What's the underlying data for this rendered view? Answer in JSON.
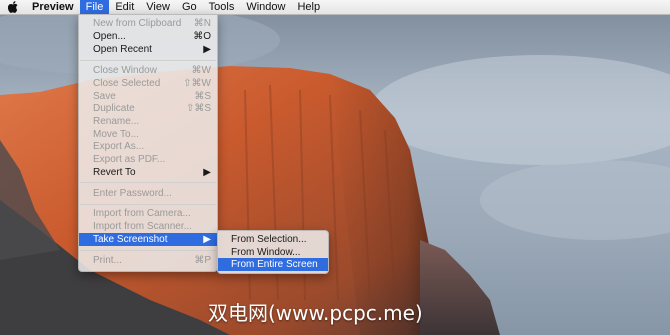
{
  "menubar": {
    "app_name": "Preview",
    "items": [
      "File",
      "Edit",
      "View",
      "Go",
      "Tools",
      "Window",
      "Help"
    ]
  },
  "file_menu": {
    "items": [
      {
        "label": "New from Clipboard",
        "shortcut": "⌘N",
        "enabled": false
      },
      {
        "label": "Open...",
        "shortcut": "⌘O",
        "enabled": true
      },
      {
        "label": "Open Recent",
        "shortcut": "▶",
        "enabled": true
      },
      {
        "label": "Close Window",
        "shortcut": "⌘W",
        "enabled": false
      },
      {
        "label": "Close Selected",
        "shortcut": "⇧⌘W",
        "enabled": false
      },
      {
        "label": "Save",
        "shortcut": "⌘S",
        "enabled": false
      },
      {
        "label": "Duplicate",
        "shortcut": "⇧⌘S",
        "enabled": false
      },
      {
        "label": "Rename...",
        "shortcut": "",
        "enabled": false
      },
      {
        "label": "Move To...",
        "shortcut": "",
        "enabled": false
      },
      {
        "label": "Export As...",
        "shortcut": "",
        "enabled": false
      },
      {
        "label": "Export as PDF...",
        "shortcut": "",
        "enabled": false
      },
      {
        "label": "Revert To",
        "shortcut": "▶",
        "enabled": true
      },
      {
        "label": "Enter Password...",
        "shortcut": "",
        "enabled": false
      },
      {
        "label": "Import from Camera...",
        "shortcut": "",
        "enabled": false
      },
      {
        "label": "Import from Scanner...",
        "shortcut": "",
        "enabled": false
      },
      {
        "label": "Take Screenshot",
        "shortcut": "▶",
        "enabled": true,
        "highlighted": true
      },
      {
        "label": "Print...",
        "shortcut": "⌘P",
        "enabled": false
      }
    ]
  },
  "screenshot_submenu": {
    "items": [
      {
        "label": "From Selection...",
        "highlighted": false
      },
      {
        "label": "From Window...",
        "highlighted": false
      },
      {
        "label": "From Entire Screen",
        "highlighted": true
      }
    ]
  },
  "watermark": "双电网(www.pcpc.me)",
  "colors": {
    "highlight": "#2e6ce0"
  }
}
